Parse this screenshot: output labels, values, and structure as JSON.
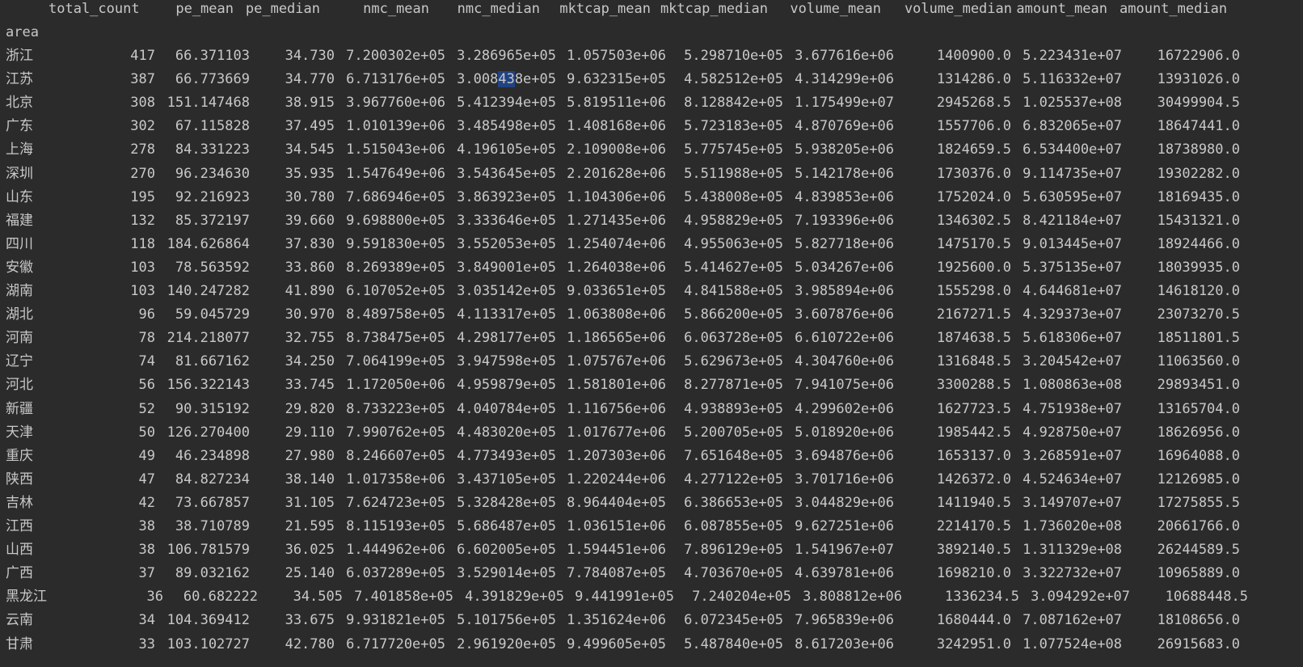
{
  "columns": [
    "total_count",
    "pe_mean",
    "pe_median",
    "nmc_mean",
    "nmc_median",
    "mktcap_mean",
    "mktcap_median",
    "volume_mean",
    "volume_median",
    "amount_mean",
    "amount_median"
  ],
  "index_name": "area",
  "rows": [
    {
      "area": "浙江",
      "values": [
        "417",
        "66.371103",
        "34.730",
        "7.200302e+05",
        "3.286965e+05",
        "1.057503e+06",
        "5.298710e+05",
        "3.677616e+06",
        "1400900.0",
        "5.223431e+07",
        "16722906.0"
      ]
    },
    {
      "area": "江苏",
      "values": [
        "387",
        "66.773669",
        "34.770",
        "6.713176e+05",
        "3.008438e+05",
        "9.632315e+05",
        "4.582512e+05",
        "4.314299e+06",
        "1314286.0",
        "5.116332e+07",
        "13931026.0"
      ]
    },
    {
      "area": "北京",
      "values": [
        "308",
        "151.147468",
        "38.915",
        "3.967760e+06",
        "5.412394e+05",
        "5.819511e+06",
        "8.128842e+05",
        "1.175499e+07",
        "2945268.5",
        "1.025537e+08",
        "30499904.5"
      ]
    },
    {
      "area": "广东",
      "values": [
        "302",
        "67.115828",
        "37.495",
        "1.010139e+06",
        "3.485498e+05",
        "1.408168e+06",
        "5.723183e+05",
        "4.870769e+06",
        "1557706.0",
        "6.832065e+07",
        "18647441.0"
      ]
    },
    {
      "area": "上海",
      "values": [
        "278",
        "84.331223",
        "34.545",
        "1.515043e+06",
        "4.196105e+05",
        "2.109008e+06",
        "5.775745e+05",
        "5.938205e+06",
        "1824659.5",
        "6.534400e+07",
        "18738980.0"
      ]
    },
    {
      "area": "深圳",
      "values": [
        "270",
        "96.234630",
        "35.935",
        "1.547649e+06",
        "3.543645e+05",
        "2.201628e+06",
        "5.511988e+05",
        "5.142178e+06",
        "1730376.0",
        "9.114735e+07",
        "19302282.0"
      ]
    },
    {
      "area": "山东",
      "values": [
        "195",
        "92.216923",
        "30.780",
        "7.686946e+05",
        "3.863923e+05",
        "1.104306e+06",
        "5.438008e+05",
        "4.839853e+06",
        "1752024.0",
        "5.630595e+07",
        "18169435.0"
      ]
    },
    {
      "area": "福建",
      "values": [
        "132",
        "85.372197",
        "39.660",
        "9.698800e+05",
        "3.333646e+05",
        "1.271435e+06",
        "4.958829e+05",
        "7.193396e+06",
        "1346302.5",
        "8.421184e+07",
        "15431321.0"
      ]
    },
    {
      "area": "四川",
      "values": [
        "118",
        "184.626864",
        "37.830",
        "9.591830e+05",
        "3.552053e+05",
        "1.254074e+06",
        "4.955063e+05",
        "5.827718e+06",
        "1475170.5",
        "9.013445e+07",
        "18924466.0"
      ]
    },
    {
      "area": "安徽",
      "values": [
        "103",
        "78.563592",
        "33.860",
        "8.269389e+05",
        "3.849001e+05",
        "1.264038e+06",
        "5.414627e+05",
        "5.034267e+06",
        "1925600.0",
        "5.375135e+07",
        "18039935.0"
      ]
    },
    {
      "area": "湖南",
      "values": [
        "103",
        "140.247282",
        "41.890",
        "6.107052e+05",
        "3.035142e+05",
        "9.033651e+05",
        "4.841588e+05",
        "3.985894e+06",
        "1555298.0",
        "4.644681e+07",
        "14618120.0"
      ]
    },
    {
      "area": "湖北",
      "values": [
        "96",
        "59.045729",
        "30.970",
        "8.489758e+05",
        "4.113317e+05",
        "1.063808e+06",
        "5.866200e+05",
        "3.607876e+06",
        "2167271.5",
        "4.329373e+07",
        "23073270.5"
      ]
    },
    {
      "area": "河南",
      "values": [
        "78",
        "214.218077",
        "32.755",
        "8.738475e+05",
        "4.298177e+05",
        "1.186565e+06",
        "6.063728e+05",
        "6.610722e+06",
        "1874638.5",
        "5.618306e+07",
        "18511801.5"
      ]
    },
    {
      "area": "辽宁",
      "values": [
        "74",
        "81.667162",
        "34.250",
        "7.064199e+05",
        "3.947598e+05",
        "1.075767e+06",
        "5.629673e+05",
        "4.304760e+06",
        "1316848.5",
        "3.204542e+07",
        "11063560.0"
      ]
    },
    {
      "area": "河北",
      "values": [
        "56",
        "156.322143",
        "33.745",
        "1.172050e+06",
        "4.959879e+05",
        "1.581801e+06",
        "8.277871e+05",
        "7.941075e+06",
        "3300288.5",
        "1.080863e+08",
        "29893451.0"
      ]
    },
    {
      "area": "新疆",
      "values": [
        "52",
        "90.315192",
        "29.820",
        "8.733223e+05",
        "4.040784e+05",
        "1.116756e+06",
        "4.938893e+05",
        "4.299602e+06",
        "1627723.5",
        "4.751938e+07",
        "13165704.0"
      ]
    },
    {
      "area": "天津",
      "values": [
        "50",
        "126.270400",
        "29.110",
        "7.990762e+05",
        "4.483020e+05",
        "1.017677e+06",
        "5.200705e+05",
        "5.018920e+06",
        "1985442.5",
        "4.928750e+07",
        "18626956.0"
      ]
    },
    {
      "area": "重庆",
      "values": [
        "49",
        "46.234898",
        "27.980",
        "8.246607e+05",
        "4.773493e+05",
        "1.207303e+06",
        "7.651648e+05",
        "3.694876e+06",
        "1653137.0",
        "3.268591e+07",
        "16964088.0"
      ]
    },
    {
      "area": "陕西",
      "values": [
        "47",
        "84.827234",
        "38.140",
        "1.017358e+06",
        "3.437105e+05",
        "1.220244e+06",
        "4.277122e+05",
        "3.701716e+06",
        "1426372.0",
        "4.524634e+07",
        "12126985.0"
      ]
    },
    {
      "area": "吉林",
      "values": [
        "42",
        "73.667857",
        "31.105",
        "7.624723e+05",
        "5.328428e+05",
        "8.964404e+05",
        "6.386653e+05",
        "3.044829e+06",
        "1411940.5",
        "3.149707e+07",
        "17275855.5"
      ]
    },
    {
      "area": "江西",
      "values": [
        "38",
        "38.710789",
        "21.595",
        "8.115193e+05",
        "5.686487e+05",
        "1.036151e+06",
        "6.087855e+05",
        "9.627251e+06",
        "2214170.5",
        "1.736020e+08",
        "20661766.0"
      ]
    },
    {
      "area": "山西",
      "values": [
        "38",
        "106.781579",
        "36.025",
        "1.444962e+06",
        "6.602005e+05",
        "1.594451e+06",
        "7.896129e+05",
        "1.541967e+07",
        "3892140.5",
        "1.311329e+08",
        "26244589.5"
      ]
    },
    {
      "area": "广西",
      "values": [
        "37",
        "89.032162",
        "25.140",
        "6.037289e+05",
        "3.529014e+05",
        "7.784087e+05",
        "4.703670e+05",
        "4.639781e+06",
        "1698210.0",
        "3.322732e+07",
        "10965889.0"
      ]
    },
    {
      "area": "黑龙江",
      "values": [
        "36",
        "60.682222",
        "34.505",
        "7.401858e+05",
        "4.391829e+05",
        "9.441991e+05",
        "7.240204e+05",
        "3.808812e+06",
        "1336234.5",
        "3.094292e+07",
        "10688448.5"
      ]
    },
    {
      "area": "云南",
      "values": [
        "34",
        "104.369412",
        "33.675",
        "9.931821e+05",
        "5.101756e+05",
        "1.351624e+06",
        "6.072345e+05",
        "7.965839e+06",
        "1680444.0",
        "7.087162e+07",
        "18108656.0"
      ]
    },
    {
      "area": "甘肃",
      "values": [
        "33",
        "103.102727",
        "42.780",
        "6.717720e+05",
        "2.961920e+05",
        "9.499605e+05",
        "5.487840e+05",
        "8.617203e+06",
        "3242951.0",
        "1.077524e+08",
        "26915683.0"
      ]
    }
  ],
  "selection": {
    "row": 1,
    "column": 4,
    "selected_text": "43"
  }
}
